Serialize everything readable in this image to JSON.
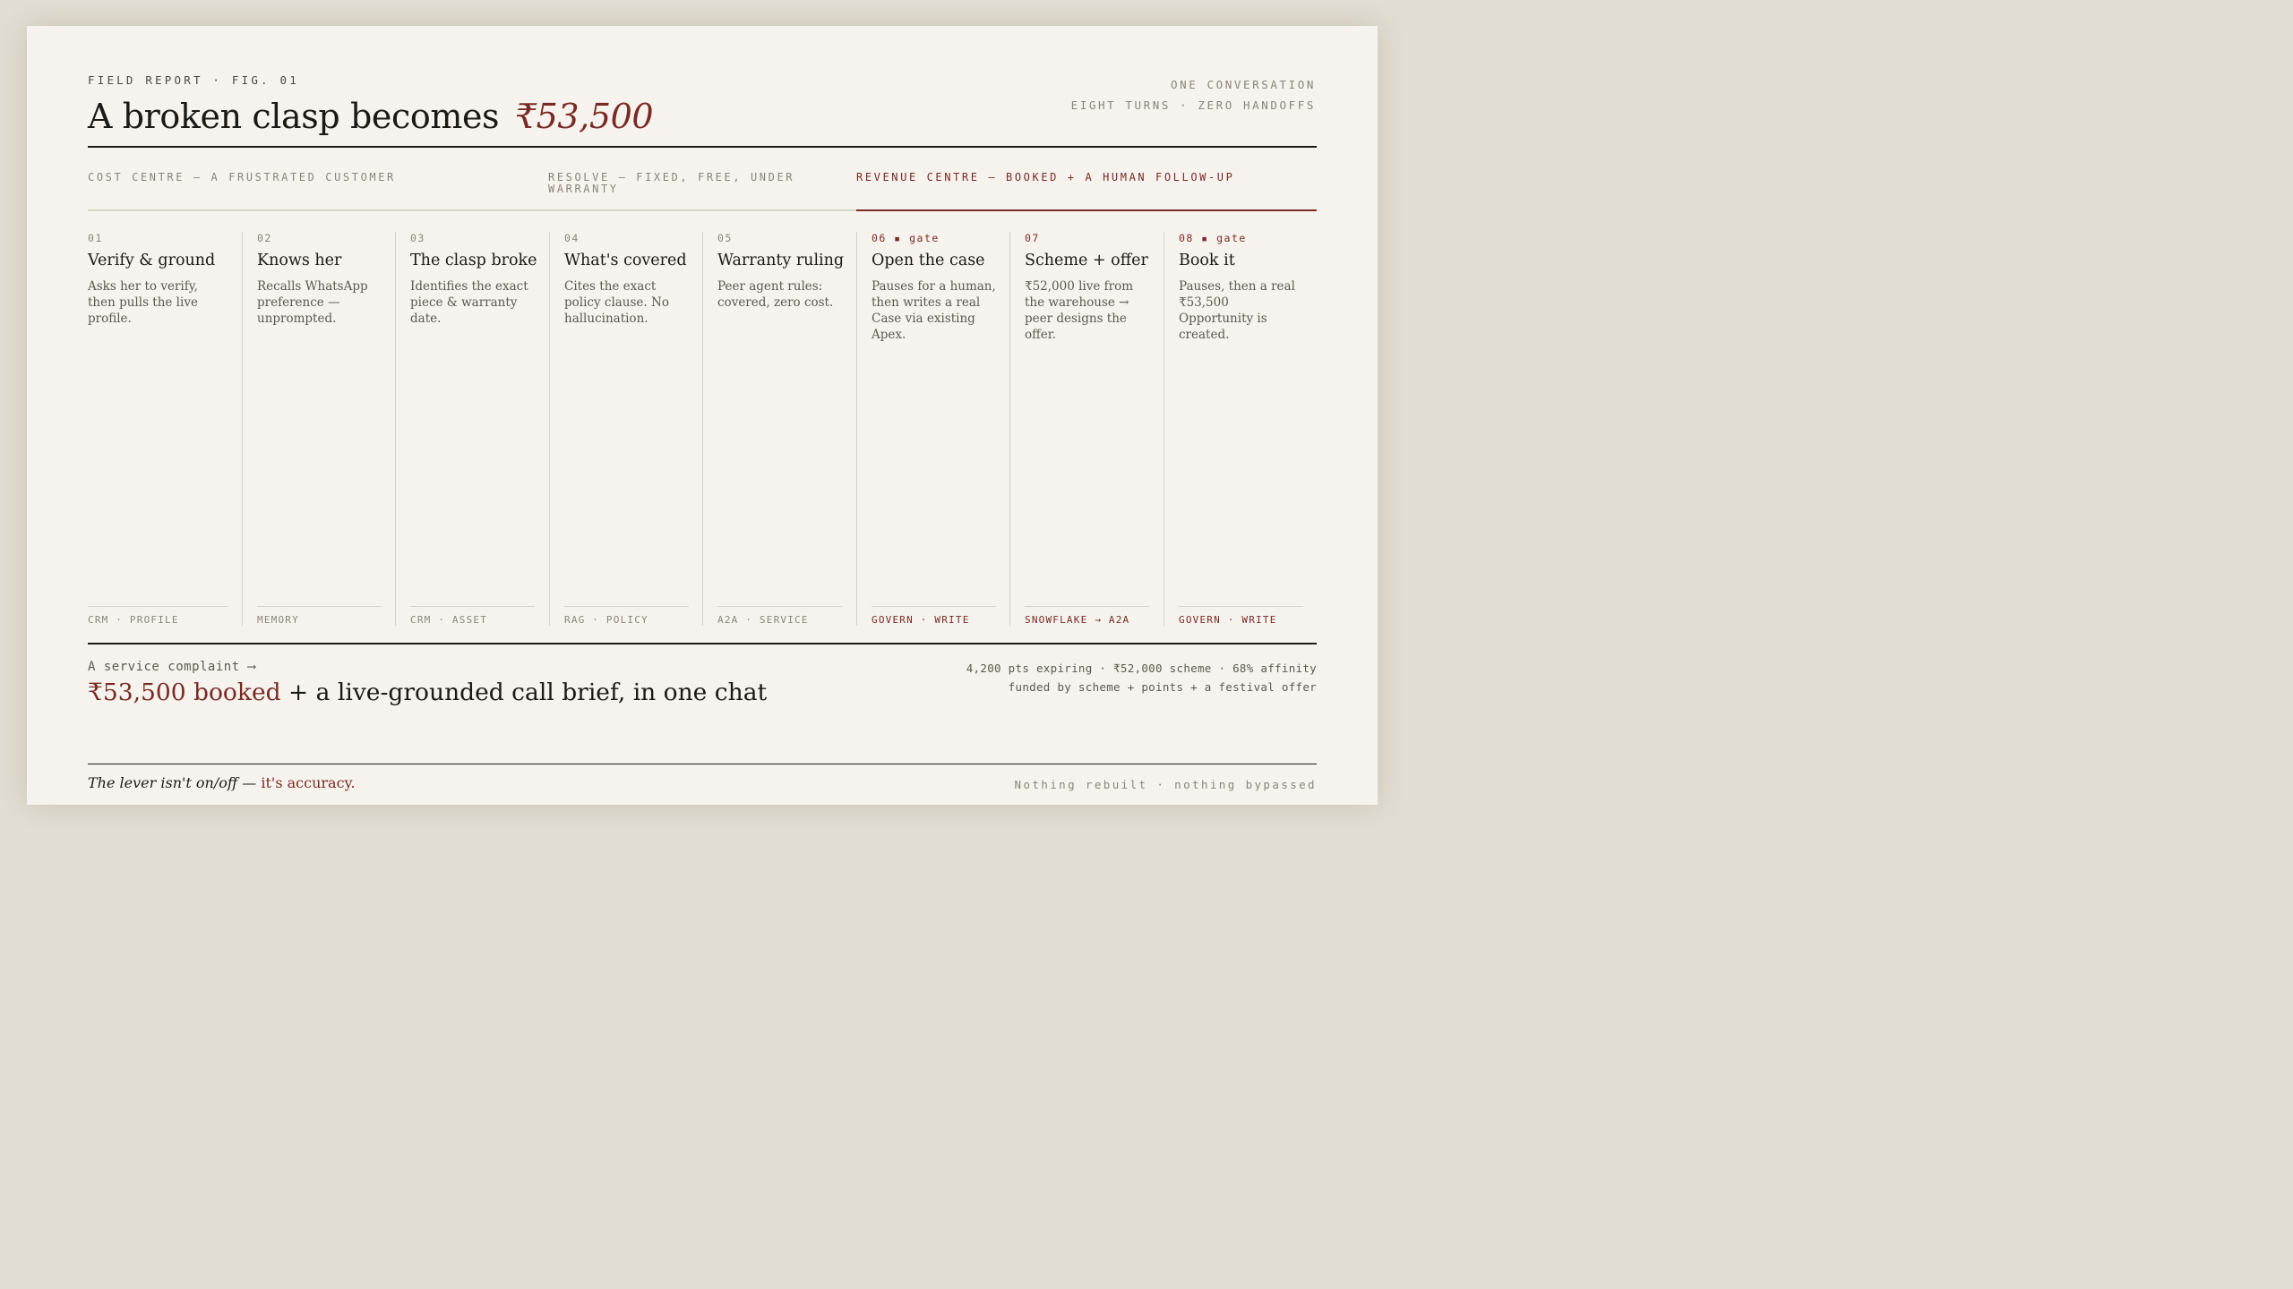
{
  "header": {
    "kicker": "FIELD REPORT · FIG. 01",
    "title_text": "A broken clasp becomes",
    "title_amount": "₹53,500",
    "meta_line1": "ONE CONVERSATION",
    "meta_line2": "EIGHT TURNS · ZERO HANDOFFS"
  },
  "phases": [
    {
      "label": "COST CENTRE — A FRUSTRATED CUSTOMER"
    },
    {
      "label": "RESOLVE — FIXED, FREE, UNDER WARRANTY"
    },
    {
      "label": "REVENUE CENTRE — BOOKED + A HUMAN FOLLOW-UP"
    }
  ],
  "steps": [
    {
      "num": "01",
      "title": "Verify & ground",
      "desc": "Asks her to verify, then pulls the live profile.",
      "tag": "CRM · PROFILE"
    },
    {
      "num": "02",
      "title": "Knows her",
      "desc": "Recalls WhatsApp preference — unprompted.",
      "tag": "MEMORY"
    },
    {
      "num": "03",
      "title": "The clasp broke",
      "desc": "Identifies the exact piece & warranty date.",
      "tag": "CRM · ASSET"
    },
    {
      "num": "04",
      "title": "What's covered",
      "desc": "Cites the exact policy clause. No hallucination.",
      "tag": "RAG · POLICY"
    },
    {
      "num": "05",
      "title": "Warranty ruling",
      "desc": "Peer agent rules: covered, zero cost.",
      "tag": "A2A · SERVICE"
    },
    {
      "num": "06 ▪ gate",
      "title": "Open the case",
      "desc": "Pauses for a human, then writes a real Case via existing Apex.",
      "tag": "GOVERN · WRITE"
    },
    {
      "num": "07",
      "title": "Scheme + offer",
      "desc": "₹52,000 live from the warehouse → peer designs the offer.",
      "tag": "SNOWFLAKE → A2A"
    },
    {
      "num": "08 ▪ gate",
      "title": "Book it",
      "desc": "Pauses, then a real ₹53,500 Opportunity is created.",
      "tag": "GOVERN · WRITE"
    }
  ],
  "summary": {
    "intro": "A service complaint ⟶",
    "headline_amount": "₹53,500 booked",
    "headline_rest": " + a live-grounded call brief, in one chat",
    "stats_line1": "4,200 pts expiring · ₹52,000 scheme · 68% affinity",
    "stats_line2": "funded by scheme + points + a festival offer"
  },
  "footer": {
    "lever_text": "The lever isn't on/off — ",
    "lever_accent": "it's accuracy.",
    "closing": "Nothing rebuilt · nothing bypassed"
  },
  "colors": {
    "accent": "#7a2a24",
    "ink": "#1c1a17",
    "paper": "#f6f3ee",
    "muted": "#8a847a"
  }
}
